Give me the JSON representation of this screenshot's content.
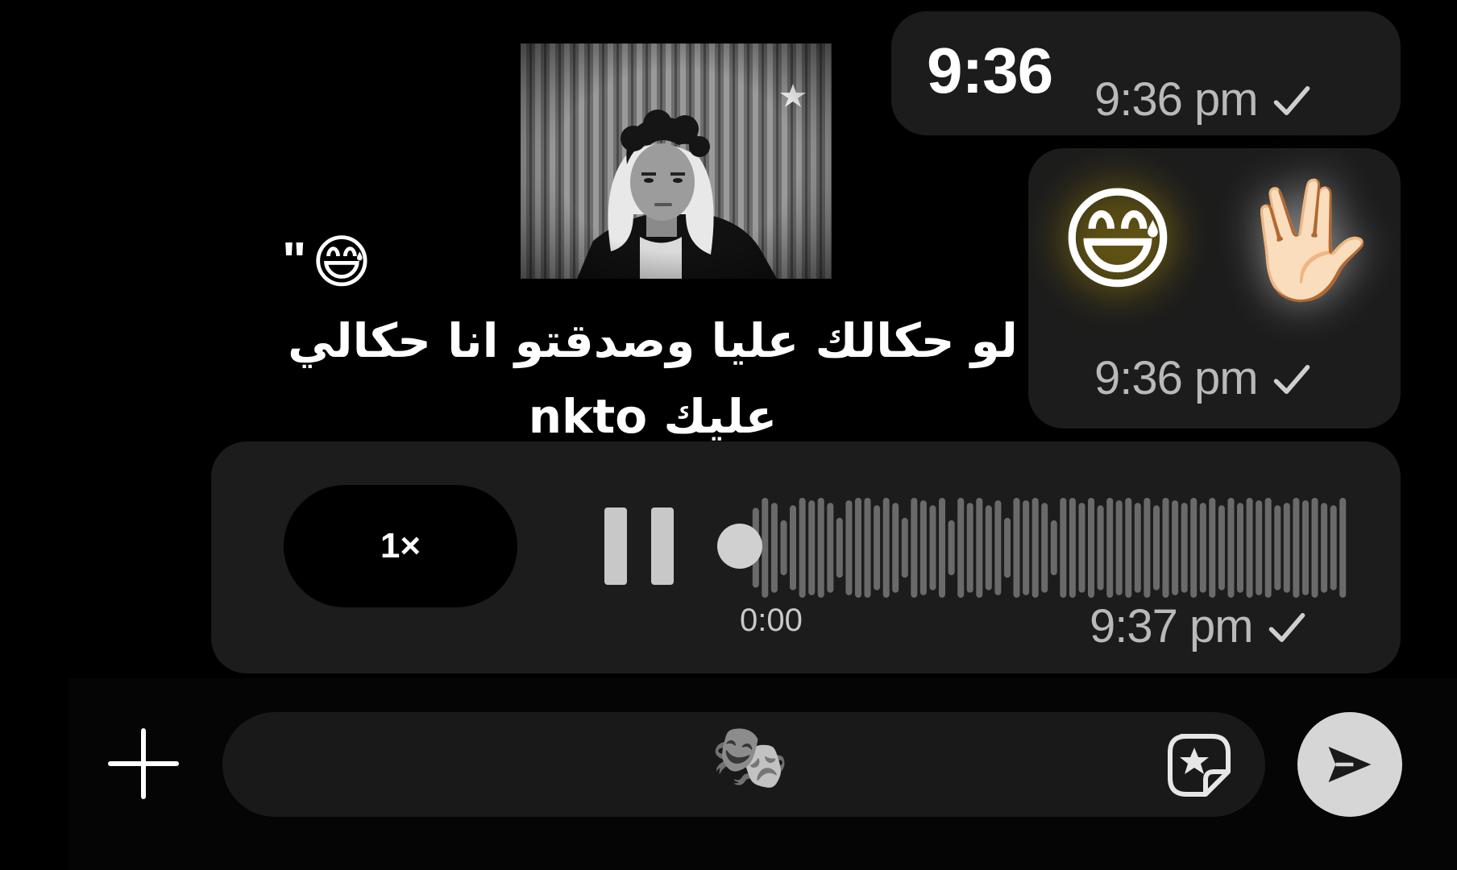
{
  "messages": [
    {
      "text": "9:36",
      "time": "9:36 pm",
      "status": "sent"
    },
    {
      "emojis": [
        "😅",
        "🖖🏻"
      ],
      "time": "9:36 pm",
      "status": "sent"
    }
  ],
  "voice_message": {
    "speed": "1×",
    "duration": "0:00",
    "time": "9:37 pm",
    "status": "sent",
    "waveform_levels": [
      0.8,
      1,
      0.9,
      0.55,
      0.85,
      1,
      0.95,
      1,
      0.9,
      0.6,
      0.95,
      1,
      1,
      0.85,
      1,
      0.9,
      0.6,
      1,
      0.95,
      0.85,
      1,
      0.55,
      1,
      0.9,
      1,
      0.85,
      0.95,
      0.6,
      1,
      0.95,
      1,
      0.9,
      0.55,
      1,
      1,
      0.9,
      1,
      0.85,
      1,
      0.95,
      1,
      0.9,
      1,
      0.85,
      1,
      0.95,
      0.9,
      1,
      0.9,
      1,
      0.85,
      1,
      0.9,
      1,
      0.95,
      1,
      0.85,
      0.9,
      1,
      0.95,
      1,
      0.9,
      0.85,
      1
    ]
  },
  "overlay": {
    "quote_mark": "\"",
    "emoji": "😅",
    "caption": "لو حكالك عليا وصدقتو انا حكالي عليك nkto"
  },
  "composer": {
    "mask_icon": "🎭",
    "accent": "#d6d6d6"
  }
}
